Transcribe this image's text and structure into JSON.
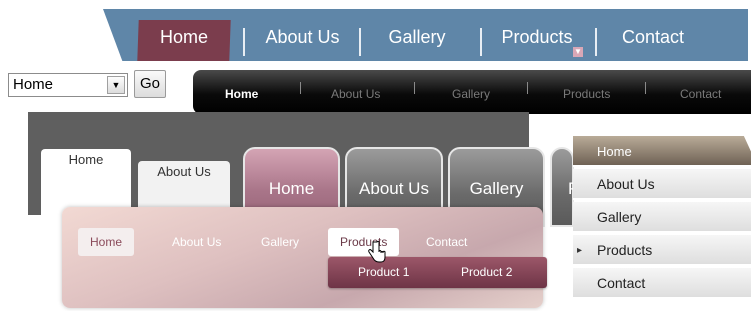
{
  "menu1": {
    "items": [
      "Home",
      "About Us",
      "Gallery",
      "Products",
      "Contact"
    ],
    "active": "Home",
    "dropdown_indicator": "▼",
    "colors": {
      "bar": "#5f86a8",
      "active": "#7b3d4d"
    }
  },
  "select": {
    "value": "Home",
    "arrow": "▼",
    "go_label": "Go"
  },
  "menu2": {
    "items": [
      "Home",
      "About Us",
      "Gallery",
      "Products",
      "Contact"
    ],
    "active": "Home"
  },
  "menu3": {
    "tabs": [
      "Home",
      "About Us"
    ]
  },
  "menu4": {
    "tabs": [
      "Home",
      "About Us",
      "Gallery",
      "P"
    ],
    "active": "Home"
  },
  "menu5": {
    "items": [
      "Home",
      "About Us",
      "Gallery",
      "Products",
      "Contact"
    ],
    "active": "Home",
    "expand_marker": "▸"
  },
  "menu6": {
    "items": [
      "Home",
      "About Us",
      "Gallery",
      "Products",
      "Contact"
    ],
    "active": "Products",
    "submenu": [
      "Product 1",
      "Product 2"
    ],
    "cursor_icon": "hand-pointer"
  }
}
